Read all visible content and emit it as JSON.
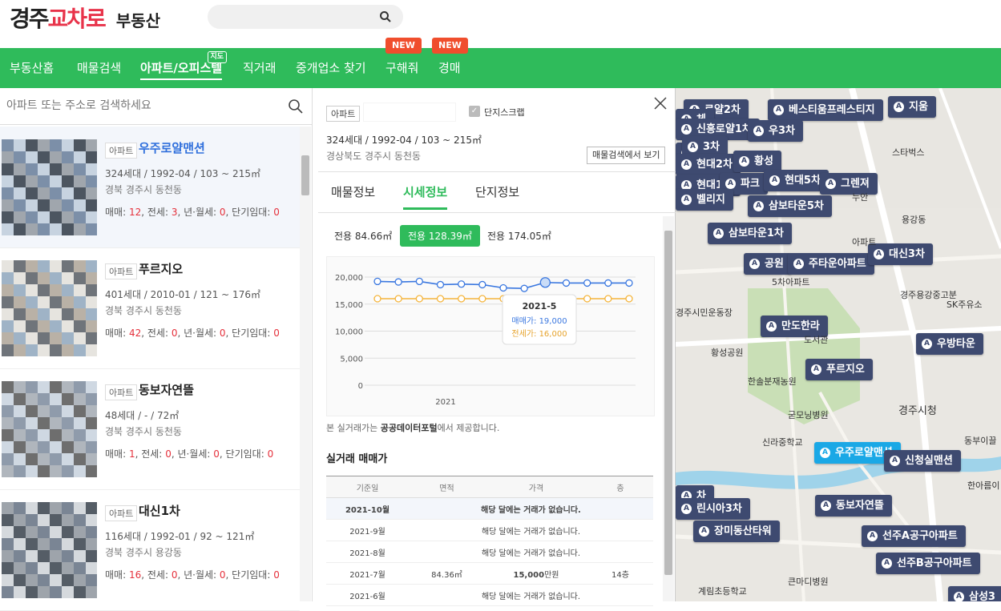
{
  "header": {
    "logo_a": "경주",
    "logo_b": "교차로",
    "logo_sub": "부동산"
  },
  "nav": {
    "items": [
      "부동산홈",
      "매물검색",
      "아파트/오피스텔",
      "직거래",
      "중개업소 찾기",
      "구해줘",
      "경매"
    ],
    "map_badge": "지도",
    "new_badge": "NEW"
  },
  "left": {
    "search_placeholder": "아파트 또는 주소로 검색하세요",
    "cards": [
      {
        "tag": "아파트",
        "name": "우주로얄맨션",
        "info": "324세대 / 1992-04 / 103 ~ 215㎡",
        "addr": "경북 경주시 동천동",
        "sale": "12",
        "jeonse": "3",
        "monthly": "0",
        "short": "0"
      },
      {
        "tag": "아파트",
        "name": "푸르지오",
        "info": "401세대 / 2010-01 / 121 ~ 176㎡",
        "addr": "경북 경주시 동천동",
        "sale": "42",
        "jeonse": "0",
        "monthly": "0",
        "short": "0"
      },
      {
        "tag": "아파트",
        "name": "동보자연뜰",
        "info": "48세대 / - / 72㎡",
        "addr": "경북 경주시 동천동",
        "sale": "1",
        "jeonse": "0",
        "monthly": "0",
        "short": "0"
      },
      {
        "tag": "아파트",
        "name": "대신1차",
        "info": "116세대 / 1992-01 / 92 ~ 121㎡",
        "addr": "경북 경주시 용강동",
        "sale": "16",
        "jeonse": "0",
        "monthly": "0",
        "short": "0"
      }
    ],
    "labels": {
      "sale": "매매:",
      "jeonse": ", 전세:",
      "monthly": ", 년·월세:",
      "short": ", 단기임대:"
    }
  },
  "detail": {
    "tag": "아파트",
    "complex_scrap": "단지스크랩",
    "summary": "324세대 / 1992-04 / 103 ~ 215㎡",
    "address": "경상북도 경주시 동천동",
    "view_btn": "매물검색에서 보기",
    "tabs": [
      "매물정보",
      "시세정보",
      "단지정보"
    ],
    "areas": [
      "전용 84.66㎡",
      "전용 128.39㎡",
      "전용 174.05㎡"
    ],
    "note_a": "본 실거래가는 ",
    "note_b": "공공데이터포털",
    "note_c": "에서 제공합니다.",
    "section_title": "실거래 매매가",
    "table_headers": [
      "기준일",
      "면적",
      "가격",
      "층"
    ],
    "rows": [
      {
        "date": "2021-10월",
        "msg": "해당 달에는 거래가 없습니다."
      },
      {
        "date": "2021-9월",
        "msg": "해당 달에는 거래가 없습니다."
      },
      {
        "date": "2021-8월",
        "msg": "해당 달에는 거래가 없습니다."
      },
      {
        "date": "2021-7월",
        "area": "84.36㎡",
        "price": "15,000",
        "unit": "만원",
        "floor": "14층"
      },
      {
        "date": "2021-6월",
        "msg": "해당 달에는 거래가 없습니다."
      }
    ]
  },
  "chart_data": {
    "type": "line",
    "x_label_year": "2021",
    "ylim": [
      0,
      20000
    ],
    "yticks": [
      0,
      5000,
      10000,
      15000,
      20000
    ],
    "series": [
      {
        "name": "매매가",
        "color": "#3b78e0",
        "values": [
          19200,
          19100,
          19200,
          18600,
          18700,
          18600,
          18000,
          17900,
          19000,
          18900,
          18900,
          18900,
          18900
        ]
      },
      {
        "name": "전세가",
        "color": "#f5b53d",
        "values": [
          16000,
          16000,
          16000,
          16000,
          16000,
          16000,
          16000,
          16000,
          16000,
          16000,
          16000,
          16000,
          16000
        ]
      }
    ],
    "tooltip": {
      "title": "2021-5",
      "sale": "매매가: 19,000",
      "jeonse": "전세가: 16,000"
    }
  },
  "map": {
    "pins": [
      {
        "t": "로얄2차"
      },
      {
        "t": "베스티움프레스티지"
      },
      {
        "t": "지움"
      },
      {
        "t": "체"
      },
      {
        "t": "신흥로얄1차"
      },
      {
        "t": "우3차"
      },
      {
        "t": "차"
      },
      {
        "t": "3차"
      },
      {
        "t": "현대2차"
      },
      {
        "t": "황성"
      },
      {
        "t": "현대1차"
      },
      {
        "t": "파크"
      },
      {
        "t": "현대5차"
      },
      {
        "t": "그렌져"
      },
      {
        "t": "벨리지"
      },
      {
        "t": "삼보타운5차"
      },
      {
        "t": "삼보타운1차"
      },
      {
        "t": "공원"
      },
      {
        "t": "주타운아파트"
      },
      {
        "t": "대신3차"
      },
      {
        "t": "만도한라"
      },
      {
        "t": "우방타운"
      },
      {
        "t": "푸르지오"
      },
      {
        "t": "우주로얄맨션"
      },
      {
        "t": "신청실맨션"
      },
      {
        "t": "차"
      },
      {
        "t": "린시아3차"
      },
      {
        "t": "동보자연뜰"
      },
      {
        "t": "장미동산타워"
      },
      {
        "t": "선주A공구아파트"
      },
      {
        "t": "선주B공구아파트"
      },
      {
        "t": "삼성3"
      }
    ],
    "labels": [
      "아파트",
      "스타벅스",
      "용강동",
      "경주용강중고분",
      "SK주유소",
      "경주시민운동장",
      "황성공원",
      "한솔분재농원",
      "굳모닝병원",
      "신라중학교",
      "경주시청",
      "동부이끌",
      "한아름이",
      "계림초등학교",
      "큰마디병원",
      "도서관",
      "5차아파트",
      "누안"
    ]
  }
}
